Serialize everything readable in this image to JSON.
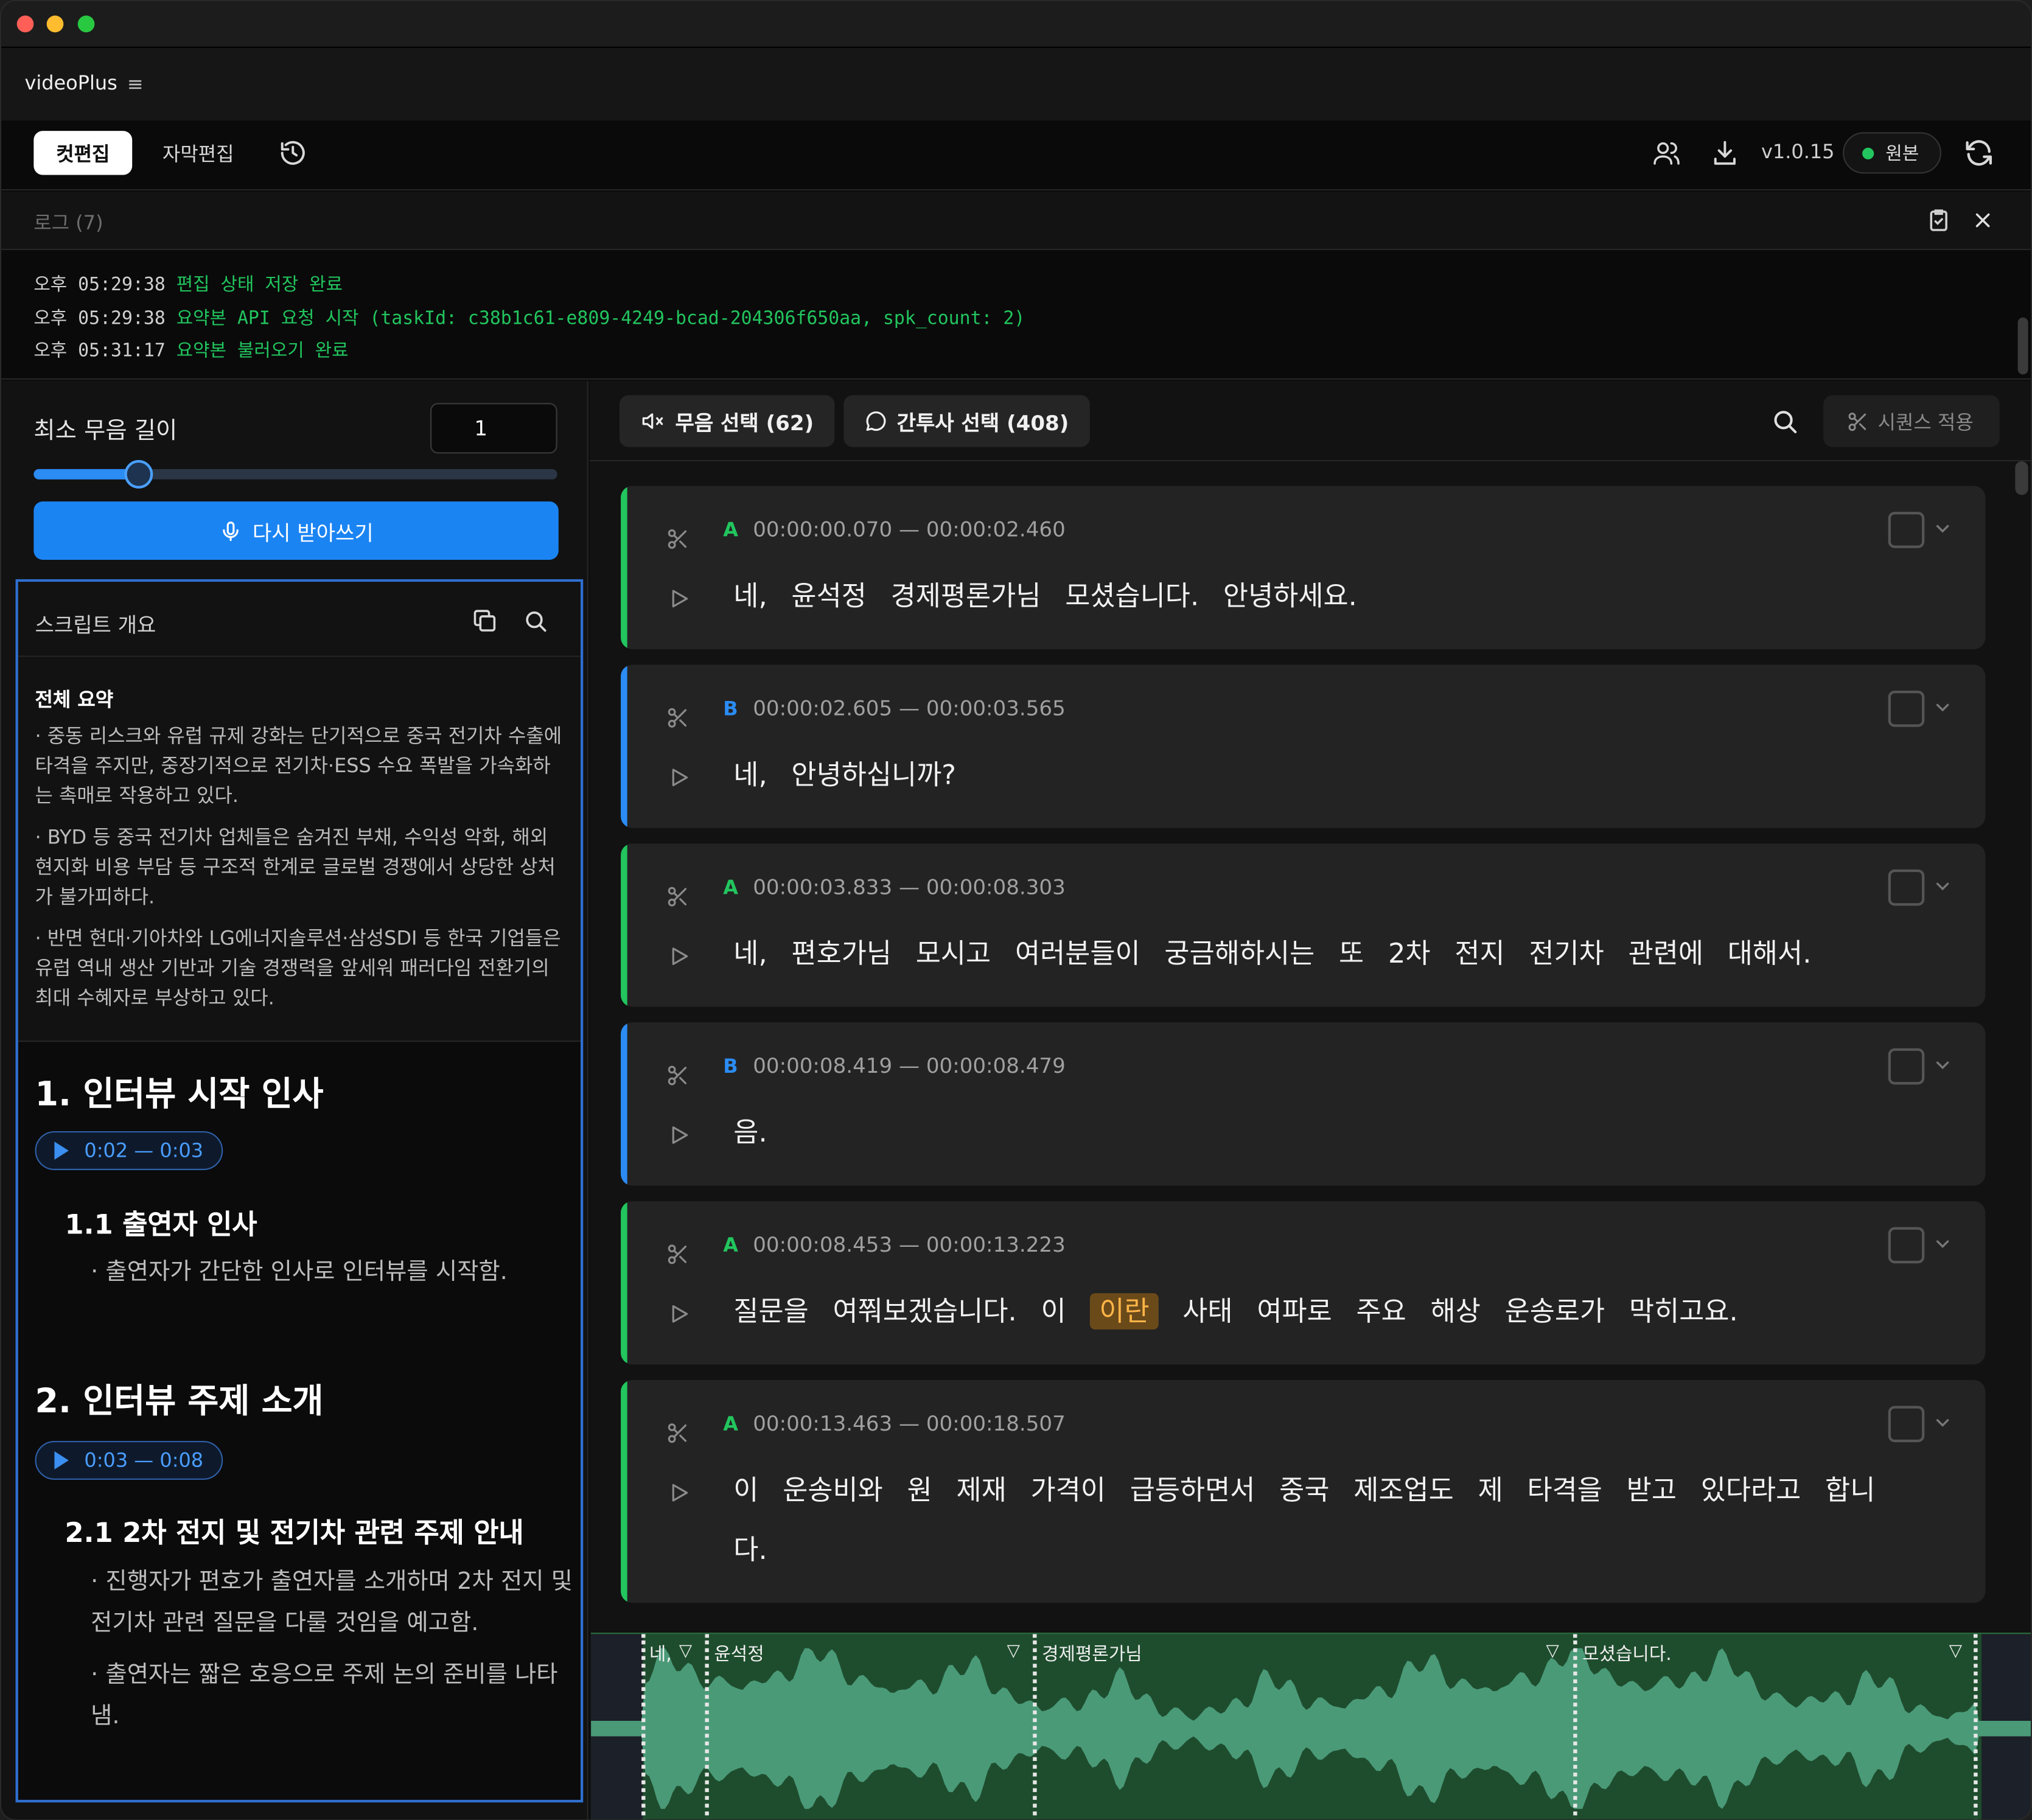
{
  "app": {
    "name": "videoPlus"
  },
  "toolbar": {
    "tab_cut": "컷편집",
    "tab_subtitle": "자막편집",
    "version": "v1.0.15",
    "status_label": "원본",
    "status_color": "#22c55e"
  },
  "log": {
    "title": "로그 (7)",
    "lines": [
      {
        "time": "오후 05:29:38",
        "msg": "편집 상태 저장 완료",
        "extra": ""
      },
      {
        "time": "오후 05:29:38",
        "msg": "요약본 API 요청 시작",
        "extra": " (taskId: c38b1c61-e809-4249-bcad-204306f650aa, spk_count: 2)"
      },
      {
        "time": "오후 05:31:17",
        "msg": "요약본 불러오기 완료",
        "extra": ""
      }
    ]
  },
  "left": {
    "min_silence_label": "최소 무음 길이",
    "min_silence_value": "1",
    "slider_fraction": 0.2,
    "redo_label": "다시 받아쓰기",
    "script_title": "스크립트 개요",
    "summary_title": "전체 요약",
    "summary": [
      "· 중동 리스크와 유럽 규제 강화는 단기적으로 중국 전기차 수출에 타격을 주지만, 중장기적으로 전기차·ESS 수요 폭발을 가속화하는 촉매로 작용하고 있다.",
      "· BYD 등 중국 전기차 업체들은 숨겨진 부채, 수익성 악화, 해외 현지화 비용 부담 등 구조적 한계로 글로벌 경쟁에서 상당한 상처가 불가피하다.",
      "· 반면 현대·기아차와 LG에너지솔루션·삼성SDI 등 한국 기업들은 유럽 역내 생산 기반과 기술 경쟁력을 앞세워 패러다임 전환기의 최대 수혜자로 부상하고 있다."
    ],
    "outline": {
      "s1_title": "1.  인터뷰 시작 인사",
      "s1_time": "0:02 — 0:03",
      "s1_sub": "1.1 출연자 인사",
      "s1_bullet": "· 출연자가 간단한 인사로 인터뷰를 시작함.",
      "s2_title": "2.  인터뷰 주제 소개",
      "s2_time": "0:03 — 0:08",
      "s2_sub": "2.1 2차 전지 및 전기차 관련 주제 안내",
      "s2_bullet1": "· 진행자가 편호가 출연자를 소개하며 2차 전지 및 전기차 관련 질문을 다룰 것임을 예고함.",
      "s2_bullet2": "· 출연자는 짧은 호응으로 주제 논의 준비를 나타냄."
    }
  },
  "right": {
    "silence_btn": "무음 선택 (62)",
    "filler_btn": "간투사 선택 (408)",
    "seq_btn": "시퀀스 적용",
    "speaker_colors": {
      "A": "#22c55e",
      "B": "#2b8cf3"
    },
    "segments": [
      {
        "speaker": "A",
        "time": "00:00:00.070 — 00:00:02.460",
        "text": "네,  윤석정  경제평론가님  모셨습니다.  안녕하세요."
      },
      {
        "speaker": "B",
        "time": "00:00:02.605 — 00:00:03.565",
        "text": "네,  안녕하십니까?"
      },
      {
        "speaker": "A",
        "time": "00:00:03.833 — 00:00:08.303",
        "text": "네,  편호가님  모시고  여러분들이  궁금해하시는  또  2차  전지  전기차  관련에  대해서."
      },
      {
        "speaker": "B",
        "time": "00:00:08.419 — 00:00:08.479",
        "text": "음."
      },
      {
        "speaker": "A",
        "time": "00:00:08.453 — 00:00:13.223",
        "text_before": "질문을  여쭤보겠습니다.  이 ",
        "text_highlight": "이란",
        "text_after": " 사태  여파로  주요  해상  운송로가  막히고요."
      },
      {
        "speaker": "A",
        "time": "00:00:13.463 — 00:00:18.507",
        "text": "이  운송비와  원  제재  가격이  급등하면서  중국  제조업도  제  타격을  받고  있다라고 합니다."
      }
    ],
    "waveform": {
      "labels": [
        "네,",
        "윤석정",
        "경제평론가님",
        "모셨습니다."
      ],
      "marker": "▽"
    }
  }
}
